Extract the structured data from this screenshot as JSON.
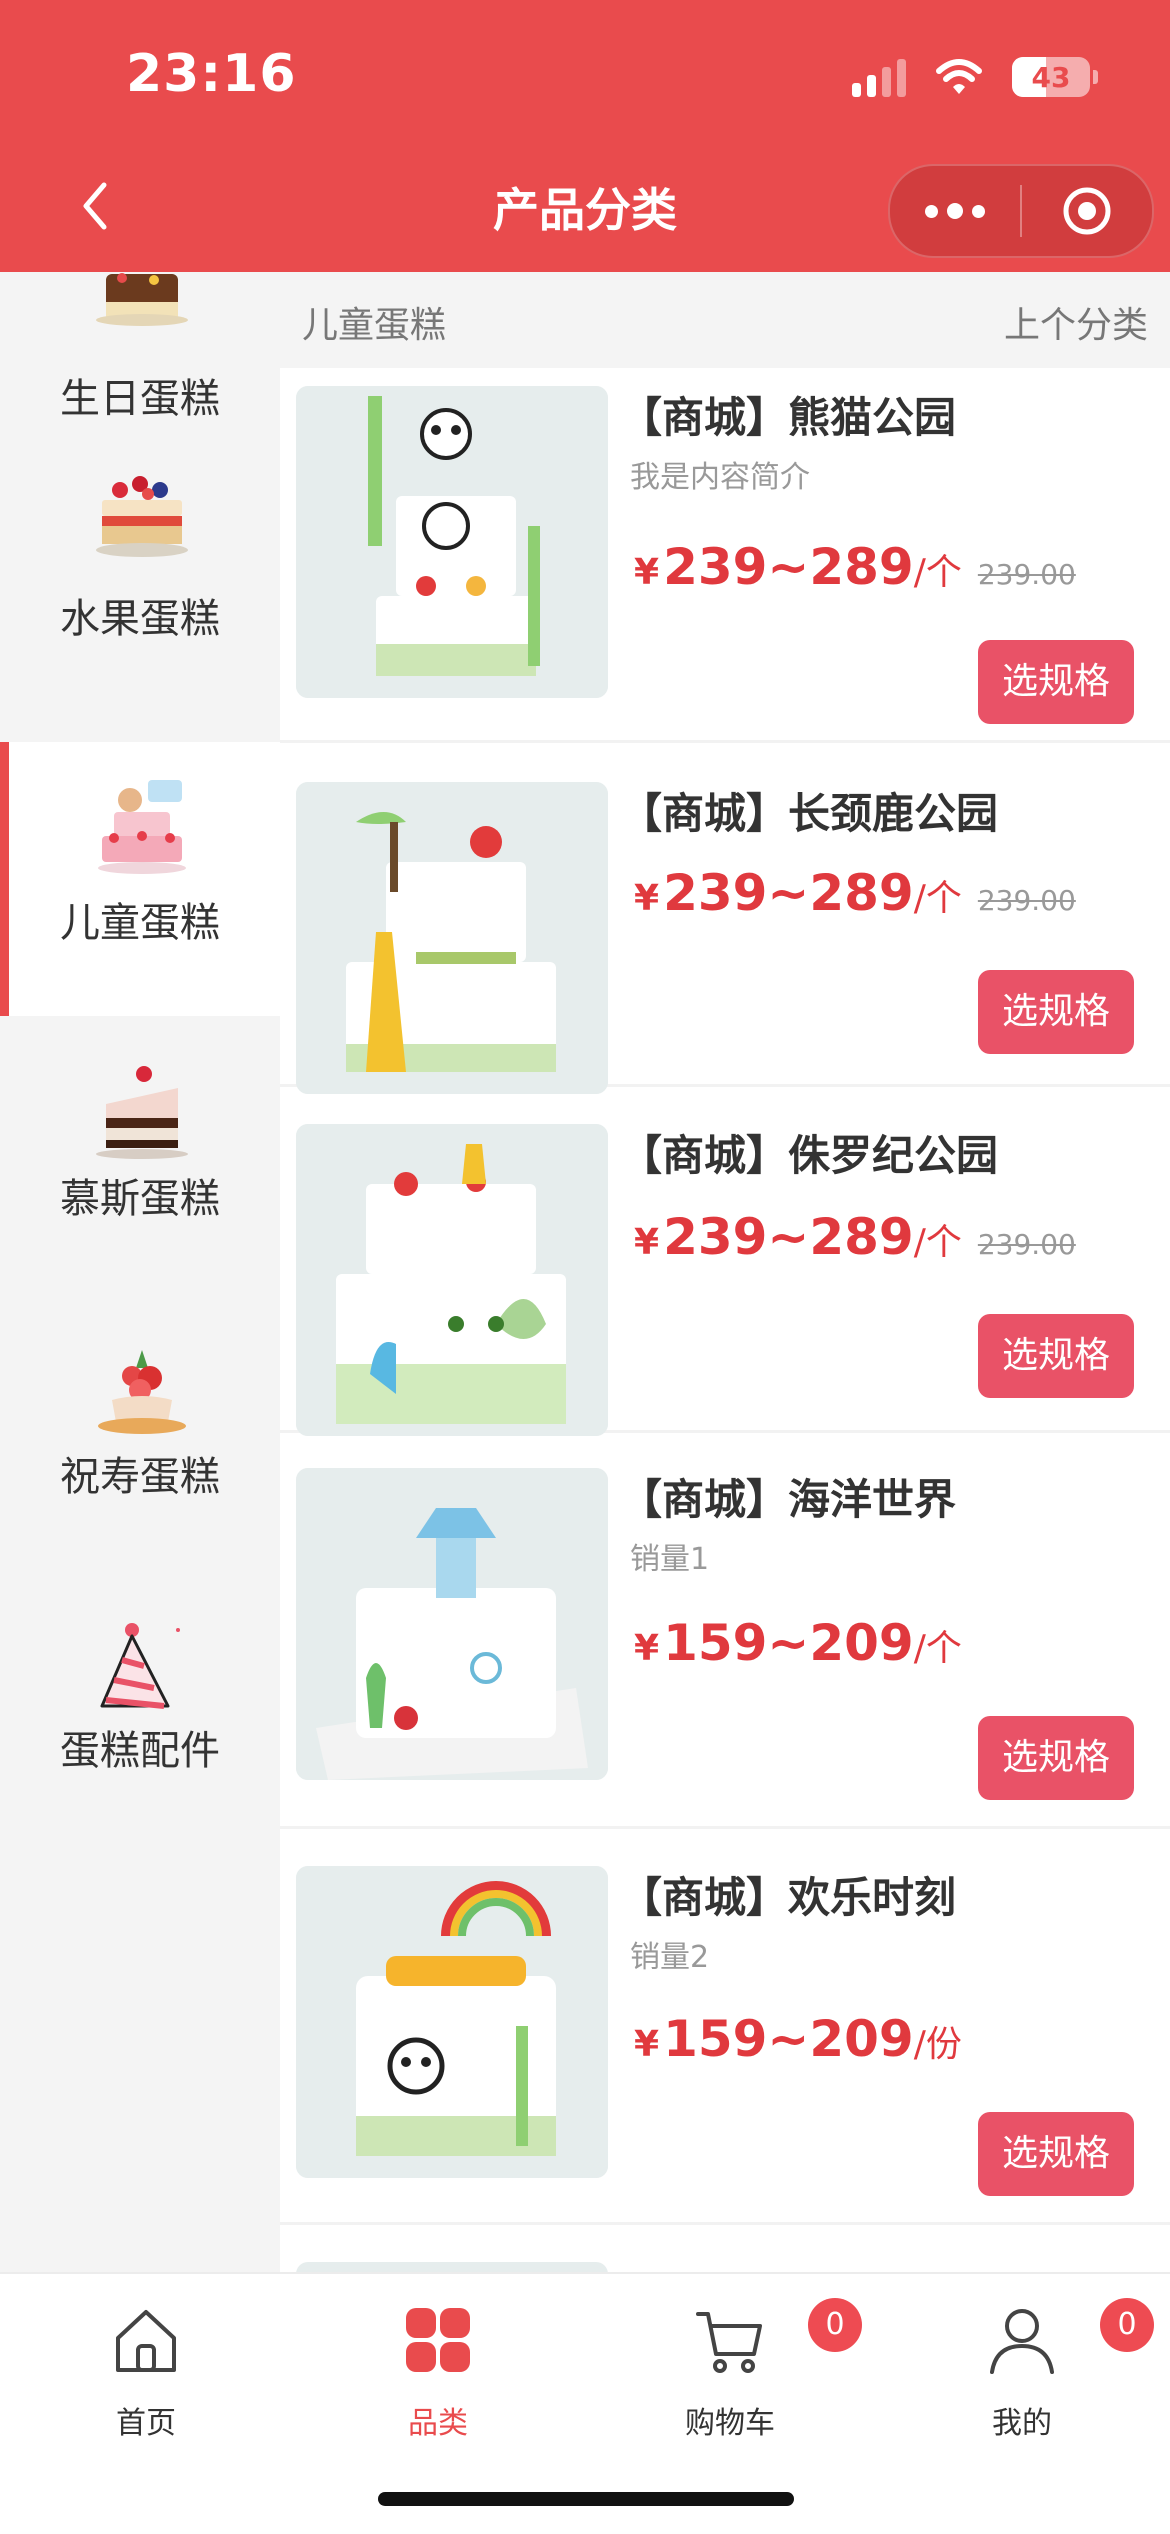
{
  "status_bar": {
    "time": "23:16",
    "battery": "43"
  },
  "nav": {
    "title": "产品分类"
  },
  "sidebar": {
    "items": [
      {
        "label": "生日蛋糕",
        "active": false
      },
      {
        "label": "水果蛋糕",
        "active": false
      },
      {
        "label": "儿童蛋糕",
        "active": true
      },
      {
        "label": "慕斯蛋糕",
        "active": false
      },
      {
        "label": "祝寿蛋糕",
        "active": false
      },
      {
        "label": "蛋糕配件",
        "active": false
      }
    ]
  },
  "category_bar": {
    "current": "儿童蛋糕",
    "prev_label": "上个分类"
  },
  "products": [
    {
      "title": "【商城】熊猫公园",
      "subtitle": "我是内容简介",
      "currency": "¥",
      "price": "239~289",
      "unit": "/个",
      "original_price": "239.00",
      "button": "选规格"
    },
    {
      "title": "【商城】长颈鹿公园",
      "subtitle": "",
      "currency": "¥",
      "price": "239~289",
      "unit": "/个",
      "original_price": "239.00",
      "button": "选规格"
    },
    {
      "title": "【商城】侏罗纪公园",
      "subtitle": "",
      "currency": "¥",
      "price": "239~289",
      "unit": "/个",
      "original_price": "239.00",
      "button": "选规格"
    },
    {
      "title": "【商城】海洋世界",
      "subtitle": "销量1",
      "currency": "¥",
      "price": "159~209",
      "unit": "/个",
      "original_price": "",
      "button": "选规格"
    },
    {
      "title": "【商城】欢乐时刻",
      "subtitle": "销量2",
      "currency": "¥",
      "price": "159~209",
      "unit": "/份",
      "original_price": "",
      "button": "选规格"
    }
  ],
  "tabbar": {
    "items": [
      {
        "label": "首页",
        "icon": "home-icon"
      },
      {
        "label": "品类",
        "icon": "category-icon",
        "active": true
      },
      {
        "label": "购物车",
        "icon": "cart-icon",
        "badge": "0"
      },
      {
        "label": "我的",
        "icon": "user-icon",
        "badge": "0"
      }
    ]
  },
  "colors": {
    "primary": "#e94b4d",
    "button": "#e95267",
    "price": "#e0393e"
  }
}
